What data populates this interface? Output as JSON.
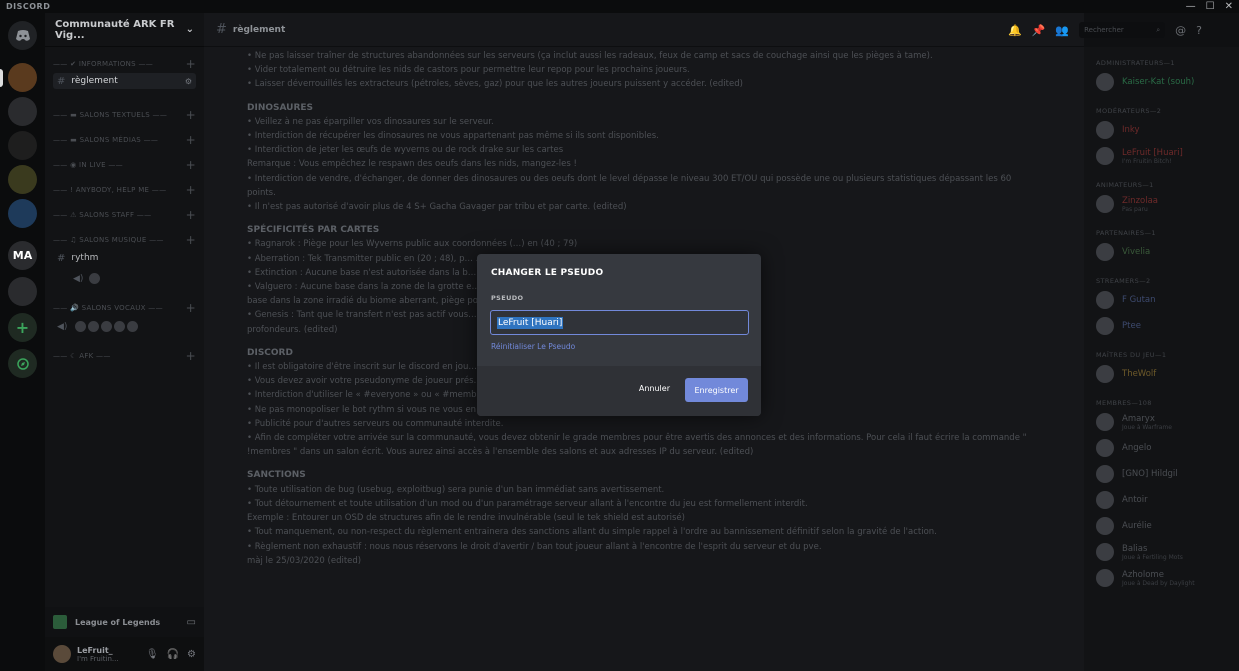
{
  "titlebar": {
    "brand": "DISCORD",
    "minimize": "—",
    "maximize": "☐",
    "close": "✕"
  },
  "rail": {
    "servers": [
      "MA"
    ]
  },
  "sidebar": {
    "guild_name": "Communauté ARK FR Vig...",
    "guild_chevron": "⌄",
    "categories": {
      "informations": "—— ✔ INFORMATIONS ——",
      "salons_textuels": "—— ▬ SALONS TEXTUELS ——",
      "salons_medias": "—— ▬ SALONS MÉDIAS ——",
      "in_live": "—— ◉ IN LIVE ——",
      "anybody_help": "—— ! ANYBODY, HELP ME ——",
      "salons_staff": "—— ⚠ SALONS STAFF ——",
      "salons_musique": "—— ♫ SALONS MUSIQUE ——",
      "salons_vocaux": "—— 🔊 SALONS VOCAUX ——",
      "afk": "—— ☾ AFK ——"
    },
    "channels": {
      "reglement": "règlement",
      "rythm": "rythm"
    },
    "activity": {
      "game": "League of Legends"
    },
    "user": {
      "name": "LeFruit_",
      "status": "I'm Fruitin..."
    }
  },
  "main": {
    "channel_title": "règlement",
    "search_placeholder": "Rechercher",
    "lines": [
      {
        "t": "•   Ne pas laisser traîner de structures abandonnées sur les serveurs (ça inclut aussi les radeaux, feux de camp et sacs de couchage ainsi que les pièges à tame)."
      },
      {
        "t": "•   Vider totalement ou détruire les nids de castors pour permettre leur repop pour les prochains joueurs."
      },
      {
        "t": "•   Laisser déverrouillés les extracteurs (pétroles, sèves, gaz) pour que les autres joueurs puissent y accéder. (edited)"
      },
      {
        "sec": "DINOSAURES"
      },
      {
        "t": "•   Veillez à ne pas éparpiller vos dinosaures sur le serveur."
      },
      {
        "t": "•   Interdiction de récupérer les dinosaures ne vous appartenant pas même si ils sont disponibles."
      },
      {
        "t": "•   Interdiction de jeter les œufs de wyverns ou de rock drake sur les cartes"
      },
      {
        "t": "Remarque : Vous empêchez le respawn des oeufs dans les nids, mangez-les !"
      },
      {
        "t": "•   Interdiction de vendre, d'échanger, de donner des dinosaures ou des oeufs dont le level dépasse le niveau 300 ET/OU qui possède une ou plusieurs statistiques dépassant les 60"
      },
      {
        "t": "points."
      },
      {
        "t": "•   Il n'est pas autorisé d'avoir plus de 4 S+ Gacha Gavager par tribu et par carte. (edited)"
      },
      {
        "sec": "SPÉCIFICITÉS PAR CARTES"
      },
      {
        "t": "•   Ragnarok : Piège pour les Wyverns public aux coordonnées (…) en (40 ; 79)"
      },
      {
        "t": "•   Aberration : Tek Transmitter public en (20 ; 48), p…                                                                          …promise pour un catalyzer"
      },
      {
        "t": "•   Extinction : Aucune base n'est autorisée dans la b…"
      },
      {
        "t": "•   Valguero : Aucune base dans la zone de la grotte e…                                                                               …un enclos marin dans l'océan souterrain (les abysses), aucune"
      },
      {
        "t": "base dans la zone irradié du biome aberrant, piège pou…                                                                         …999)"
      },
      {
        "t": "•   Genesis : Tant que le transfert n'est pas actif vous…                                                                              …au maximum la taille d'une plateforme océanique avec 14 de"
      },
      {
        "t": "profondeurs. (edited)"
      },
      {
        "sec": "DISCORD"
      },
      {
        "t": "•   Il est obligatoire d'être inscrit sur le discord en jou…"
      },
      {
        "t": "•   Vous devez avoir votre pseudonyme de joueur prés…"
      },
      {
        "t": "•   Interdiction d'utiliser le « #everyone » ou « #membres » pour rien."
      },
      {
        "t": "•   Ne pas monopoliser le bot rythm si vous ne vous en servez pas."
      },
      {
        "t": "•   Publicité pour d'autres serveurs ou communauté interdite."
      },
      {
        "t": "•   Afin de compléter votre arrivée sur la communauté, vous devez obtenir le grade membres pour être avertis des annonces et des informations. Pour cela il faut écrire la commande \""
      },
      {
        "t": "!membres \" dans un salon écrit. Vous aurez ainsi accès à l'ensemble des salons et aux adresses IP du serveur. (edited)"
      },
      {
        "sec": "SANCTIONS"
      },
      {
        "t": "•   Toute utilisation de bug (usebug, exploitbug) sera punie d'un ban immédiat sans avertissement."
      },
      {
        "t": "•   Tout détournement et toute utilisation d'un mod ou d'un paramétrage serveur allant à l'encontre du jeu est formellement interdit."
      },
      {
        "t": "Exemple : Entourer un OSD de structures afin de le rendre invulnérable (seul le tek shield est autorisé)"
      },
      {
        "t": "•   Tout manquement, ou non-respect du règlement entrainera des sanctions allant du simple rappel à l'ordre au bannissement définitif selon la gravité de l'action."
      },
      {
        "t": "•   Règlement non exhaustif : nous nous réservons le droit d'avertir / ban tout joueur allant à l'encontre de l'esprit du serveur et du pve."
      },
      {
        "t": " "
      },
      {
        "t": "màj le 25/03/2020 (edited)"
      }
    ]
  },
  "members": {
    "groups": [
      {
        "label": "ADMINISTRATEURS—1",
        "items": [
          {
            "name": "Kaiser-Kat (souh)",
            "color": "#2a6b46"
          }
        ]
      },
      {
        "label": "MODÉRATEURS—2",
        "items": [
          {
            "name": "Inky",
            "color": "#6e2a2a"
          },
          {
            "name": "LeFruit [Huari]",
            "color": "#6e2a2a",
            "status": "I'm Fruitin Bitch!"
          }
        ]
      },
      {
        "label": "ANIMATEURS—1",
        "items": [
          {
            "name": "Zinzolaa",
            "color": "#6e2a2a",
            "status": "Pas paru"
          }
        ]
      },
      {
        "label": "PARTENAIRES—1",
        "items": [
          {
            "name": "Vivelia",
            "color": "#3a5a3a"
          }
        ]
      },
      {
        "label": "STREAMERS—2",
        "items": [
          {
            "name": "F Gutan",
            "color": "#3d4a6e"
          },
          {
            "name": "Ptee",
            "color": "#3d4a6e"
          }
        ]
      },
      {
        "label": "MAÎTRES DU JEU—1",
        "items": [
          {
            "name": "TheWolf",
            "color": "#6e5a2a"
          }
        ]
      },
      {
        "label": "MEMBRES—108",
        "items": [
          {
            "name": "Amaryx",
            "color": "#4b4e53",
            "status": "Joue à Warframe"
          },
          {
            "name": "Angelo",
            "color": "#4b4e53"
          },
          {
            "name": "[GNO] Hildgil",
            "color": "#4b4e53"
          },
          {
            "name": "Antoir",
            "color": "#4b4e53"
          },
          {
            "name": "Aurélie",
            "color": "#4b4e53"
          },
          {
            "name": "Balias",
            "color": "#4b4e53",
            "status": "Joue à Fertiling Mots"
          },
          {
            "name": "Azholome",
            "color": "#4b4e53",
            "status": "Joue à Dead by Daylight"
          }
        ]
      }
    ]
  },
  "modal": {
    "title": "CHANGER LE PSEUDO",
    "label": "PSEUDO",
    "value": "LeFruit [Huari]",
    "reset_link": "Réinitialiser Le Pseudo",
    "cancel": "Annuler",
    "save": "Enregistrer",
    "accent": "#7289da"
  }
}
